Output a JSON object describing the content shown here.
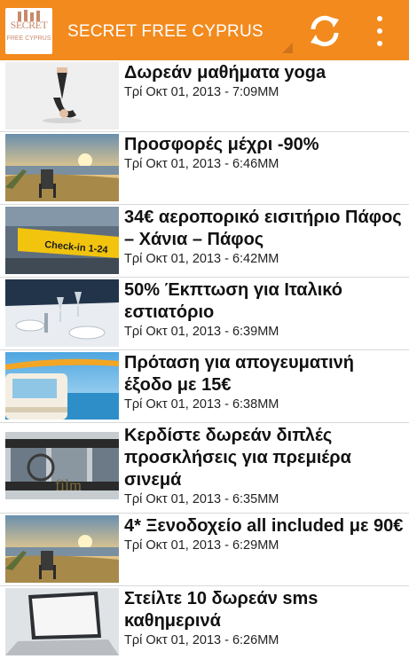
{
  "app": {
    "logo_text": "SECRET",
    "logo_subtext": "FREE CYPRUS",
    "title": "SECRET FREE CYPRUS",
    "refresh_icon": "refresh-icon",
    "menu_icon": "overflow-menu-icon",
    "accent_color": "#f28a1e"
  },
  "items": [
    {
      "title": "Δωρεάν μαθήματα yoga",
      "date": "Τρί Οκτ 01, 2013 - 7:09MM",
      "image": "yoga"
    },
    {
      "title": "Προσφορές μέχρι -90%",
      "date": "Τρί Οκτ 01, 2013 - 6:46MM",
      "image": "beach-chair"
    },
    {
      "title": "34€ αεροπορικό εισιτήριο Πάφος – Χάνια – Πάφος",
      "date": "Τρί Οκτ 01, 2013 - 6:42MM",
      "image": "checkin-sign",
      "image_text": "Check-in 1-24"
    },
    {
      "title": "50% Έκπτωση για Ιταλικό εστιατόριο",
      "date": "Τρί Οκτ 01, 2013 - 6:39MM",
      "image": "restaurant-table"
    },
    {
      "title": "Πρόταση για απογευματινή έξοδο με 15€",
      "date": "Τρί Οκτ 01, 2013 - 6:38MM",
      "image": "van-surfboard"
    },
    {
      "title": "Κερδίστε δωρεάν διπλές προσκλήσεις για πρεμιέρα σινεμά",
      "date": "Τρί Οκτ 01, 2013 - 6:35MM",
      "image": "film-strip",
      "image_text": "film"
    },
    {
      "title": "4* Ξενοδοχείο all included με 90€",
      "date": "Τρί Οκτ 01, 2013 - 6:29MM",
      "image": "beach-chair"
    },
    {
      "title": "Στείλτε 10 δωρεάν sms καθημερινά",
      "date": "Τρί Οκτ 01, 2013 - 6:26MM",
      "image": "laptop"
    }
  ]
}
